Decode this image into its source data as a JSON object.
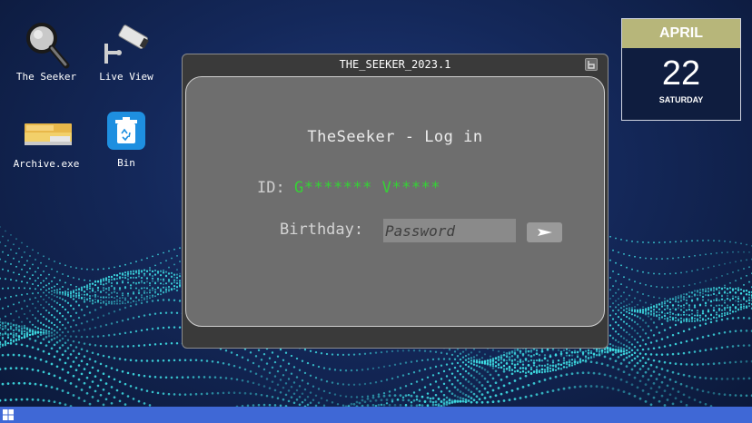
{
  "desktop": {
    "icons": [
      {
        "label": "The Seeker",
        "icon": "magnifier-icon"
      },
      {
        "label": "Live View",
        "icon": "security-camera-icon"
      },
      {
        "label": "Archive.exe",
        "icon": "folder-stack-icon"
      },
      {
        "label": "Bin",
        "icon": "recycle-bin-icon"
      }
    ]
  },
  "calendar": {
    "month": "APRIL",
    "day": "22",
    "weekday": "SATURDAY",
    "colors": {
      "header": "#b7b67a",
      "body": "#0f1d3f"
    }
  },
  "window": {
    "title": "THE_SEEKER_2023.1",
    "login_title": "TheSeeker - Log in",
    "id_label": "ID:",
    "id_value": "G******* V*****",
    "birthday_label": "Birthday:",
    "password_placeholder": "Password",
    "submit_icon": "arrow-right-icon",
    "colors": {
      "id_value": "#35d235",
      "panel": "#6e6e6e"
    }
  },
  "taskbar": {
    "start_icon": "windows-logo-icon",
    "color": "#3f68d6"
  }
}
